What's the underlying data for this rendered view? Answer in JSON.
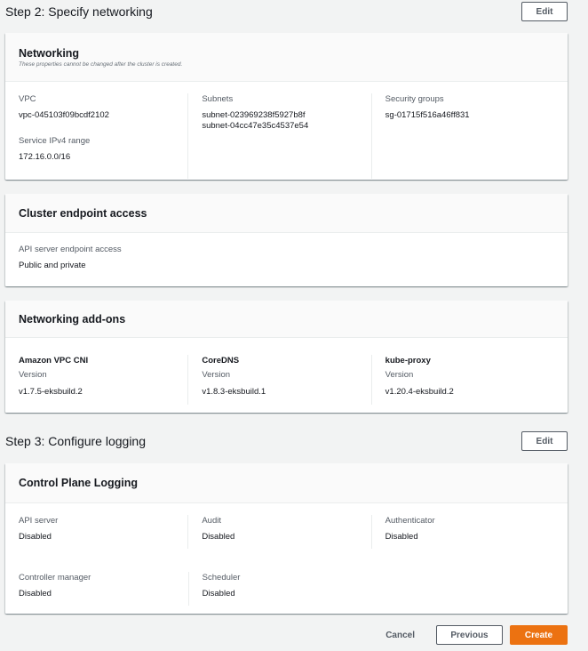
{
  "step2": {
    "title": "Step 2: Specify networking",
    "edit_label": "Edit",
    "networking": {
      "title": "Networking",
      "description": "These properties cannot be changed after the cluster is created.",
      "vpc_label": "VPC",
      "vpc_value": "vpc-045103f09bcdf2102",
      "ipv4_label": "Service IPv4 range",
      "ipv4_value": "172.16.0.0/16",
      "subnets_label": "Subnets",
      "subnets": [
        "subnet-023969238f5927b8f",
        "subnet-04cc47e35c4537e54"
      ],
      "sg_label": "Security groups",
      "sg_value": "sg-01715f516a46ff831"
    },
    "endpoint": {
      "title": "Cluster endpoint access",
      "label": "API server endpoint access",
      "value": "Public and private"
    },
    "addons": {
      "title": "Networking add-ons",
      "items": [
        {
          "name": "Amazon VPC CNI",
          "version_label": "Version",
          "version": "v1.7.5-eksbuild.2"
        },
        {
          "name": "CoreDNS",
          "version_label": "Version",
          "version": "v1.8.3-eksbuild.1"
        },
        {
          "name": "kube-proxy",
          "version_label": "Version",
          "version": "v1.20.4-eksbuild.2"
        }
      ]
    }
  },
  "step3": {
    "title": "Step 3: Configure logging",
    "edit_label": "Edit",
    "logging": {
      "title": "Control Plane Logging",
      "items": [
        {
          "label": "API server",
          "value": "Disabled"
        },
        {
          "label": "Audit",
          "value": "Disabled"
        },
        {
          "label": "Authenticator",
          "value": "Disabled"
        },
        {
          "label": "Controller manager",
          "value": "Disabled"
        },
        {
          "label": "Scheduler",
          "value": "Disabled"
        }
      ]
    }
  },
  "footer": {
    "cancel_label": "Cancel",
    "previous_label": "Previous",
    "create_label": "Create"
  },
  "colors": {
    "primary": "#ec7211",
    "background": "#f2f3f3"
  }
}
